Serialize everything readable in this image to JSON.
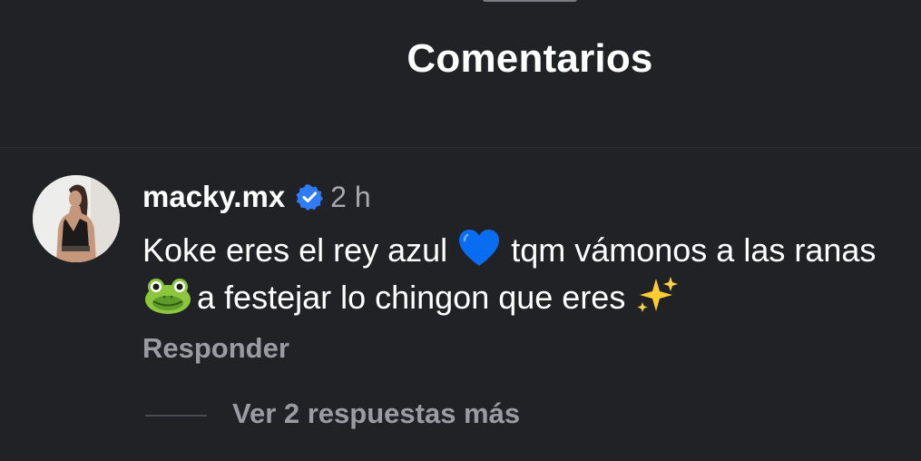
{
  "sheet": {
    "title": "Comentarios"
  },
  "comment": {
    "username": "macky.mx",
    "verified_icon": "verified-badge-icon",
    "time": "2 h",
    "text_part1": "Koke eres el rey azul",
    "emoji1": "blue-heart-emoji",
    "text_part2": "tqm vámonos a las ranas",
    "emoji2": "frog-emoji",
    "text_part3": "a festejar lo chingon que eres",
    "emoji3": "sparkles-emoji",
    "reply_label": "Responder",
    "more_replies_label": "Ver 2 respuestas más"
  },
  "colors": {
    "background": "#212226",
    "verified_blue": "#2f7cf6",
    "muted_text": "#9b9ca2"
  }
}
